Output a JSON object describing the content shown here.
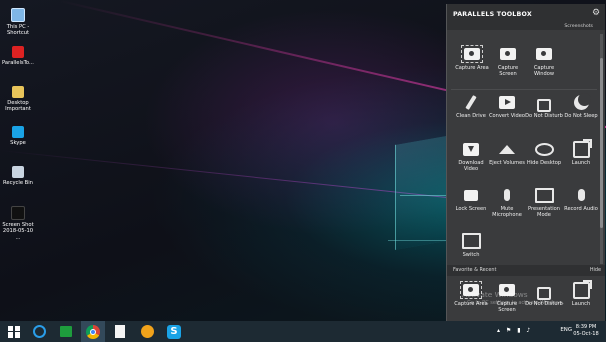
{
  "desktop": {
    "icons": [
      {
        "label": "This PC - Shortcut",
        "icon": "computer-icon"
      },
      {
        "label": "ParallelsTo...",
        "icon": "parallels-icon"
      },
      {
        "label": "Desktop Important",
        "icon": "folder-icon"
      },
      {
        "label": "Skype",
        "icon": "skype-icon"
      },
      {
        "label": "Recycle Bin",
        "icon": "recycle-bin-icon"
      },
      {
        "label": "Screen Shot 2018-05-10 ...",
        "icon": "screenshot-file-icon"
      }
    ],
    "watermark_line1": "Activate Windows",
    "watermark_line2": "Go to PC settings to activate Windows."
  },
  "toolbox": {
    "title": "PARALLELS TOOLBOX",
    "section_label": "Screenshots",
    "screenshot_tools": [
      {
        "label": "Capture Area",
        "icon": "capture-area-icon"
      },
      {
        "label": "Capture Screen",
        "icon": "capture-screen-icon"
      },
      {
        "label": "Capture Window",
        "icon": "capture-window-icon"
      }
    ],
    "tools": [
      {
        "label": "Clean Drive",
        "icon": "broom-icon"
      },
      {
        "label": "Convert Video",
        "icon": "video-icon"
      },
      {
        "label": "Do Not Disturb",
        "icon": "lock-icon"
      },
      {
        "label": "Do Not Sleep",
        "icon": "moon-icon"
      },
      {
        "label": "Download Video",
        "icon": "download-icon"
      },
      {
        "label": "Eject Volumes",
        "icon": "eject-icon"
      },
      {
        "label": "Hide Desktop",
        "icon": "eye-icon"
      },
      {
        "label": "Launch",
        "icon": "launch-icon"
      },
      {
        "label": "Lock Screen",
        "icon": "lock-screen-icon"
      },
      {
        "label": "Mute Microphone",
        "icon": "microphone-icon"
      },
      {
        "label": "Presentation Mode",
        "icon": "presentation-icon"
      },
      {
        "label": "Record Audio",
        "icon": "record-audio-icon"
      },
      {
        "label": "Switch",
        "icon": "switch-icon"
      }
    ],
    "favorites_label": "Favorite & Recent",
    "hide_label": "Hide",
    "favorites": [
      {
        "label": "Capture Area",
        "icon": "capture-area-icon"
      },
      {
        "label": "Capture Screen",
        "icon": "capture-screen-icon"
      },
      {
        "label": "Do Not Disturb",
        "icon": "lock-icon"
      },
      {
        "label": "Launch",
        "icon": "launch-icon"
      }
    ]
  },
  "taskbar": {
    "apps": [
      "start-icon",
      "internet-explorer-icon",
      "store-icon",
      "chrome-icon",
      "file-icon",
      "coin-icon",
      "skype-icon"
    ],
    "active_app": "chrome-icon",
    "tray_icons": "▴ ⚑ ▮ ♪",
    "language": "ENG",
    "time": "8:39 PM",
    "date": "05-Oct-18"
  }
}
